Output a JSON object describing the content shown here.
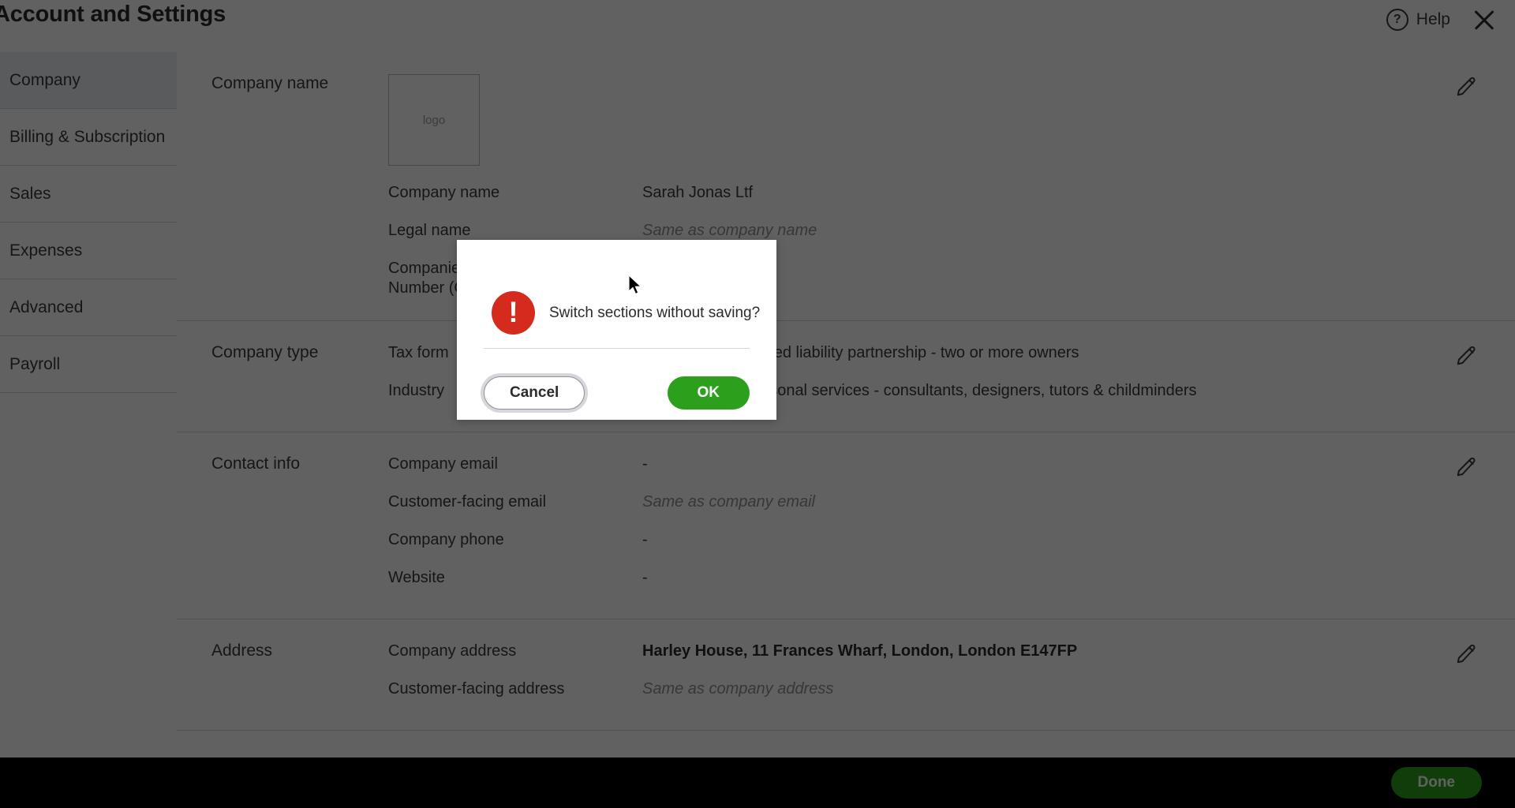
{
  "header": {
    "title": "Account and Settings",
    "help_label": "Help",
    "help_icon": "question-circle-icon",
    "close_icon": "close-icon"
  },
  "sidebar": {
    "items": [
      {
        "label": "Company",
        "active": true
      },
      {
        "label": "Billing & Subscription",
        "active": false
      },
      {
        "label": "Sales",
        "active": false
      },
      {
        "label": "Expenses",
        "active": false
      },
      {
        "label": "Advanced",
        "active": false
      },
      {
        "label": "Payroll",
        "active": false
      }
    ]
  },
  "sections": [
    {
      "title": "Company name",
      "logo_placeholder": "logo",
      "edit_icon": "pencil-icon",
      "rows": [
        {
          "label": "Company name",
          "value": "Sarah Jonas Ltf",
          "style": "normal"
        },
        {
          "label": "Legal name",
          "value": "Same as company name",
          "style": "muted"
        },
        {
          "label": "Companies House Registration Number (CRN)",
          "value": "-",
          "style": "normal"
        }
      ]
    },
    {
      "title": "Company type",
      "edit_icon": "pencil-icon",
      "rows": [
        {
          "label": "Tax form",
          "value": "Partnership or limited liability partnership - two or more owners",
          "style": "normal"
        },
        {
          "label": "Industry",
          "value": "Miscellaneous personal services - consultants, designers, tutors & childminders",
          "style": "normal"
        }
      ]
    },
    {
      "title": "Contact info",
      "edit_icon": "pencil-icon",
      "rows": [
        {
          "label": "Company email",
          "value": "-",
          "style": "normal"
        },
        {
          "label": "Customer-facing email",
          "value": "Same as company email",
          "style": "muted"
        },
        {
          "label": "Company phone",
          "value": "-",
          "style": "normal"
        },
        {
          "label": "Website",
          "value": "-",
          "style": "normal"
        }
      ]
    },
    {
      "title": "Address",
      "edit_icon": "pencil-icon",
      "rows": [
        {
          "label": "Company address",
          "value": "Harley House, 11 Frances Wharf, London, London E147FP",
          "style": "strong"
        },
        {
          "label": "Customer-facing address",
          "value": "Same as company address",
          "style": "muted"
        }
      ]
    }
  ],
  "footer": {
    "done_label": "Done"
  },
  "modal": {
    "icon": "warning-exclamation-icon",
    "message": "Switch sections without saving?",
    "cancel_label": "Cancel",
    "ok_label": "OK"
  },
  "colors": {
    "accent_green": "#2CA01C",
    "warning_red": "#D52B1E",
    "text_dark": "#393A3D",
    "border": "#D4D7DC"
  },
  "cursor": {
    "icon": "mouse-pointer-icon"
  }
}
